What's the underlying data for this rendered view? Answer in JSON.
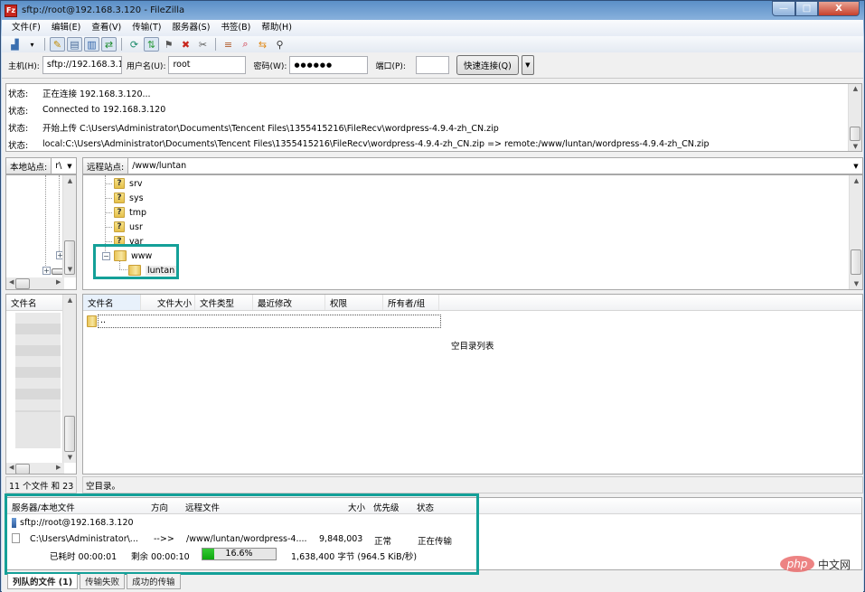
{
  "window": {
    "title": "sftp://root@192.168.3.120 - FileZilla",
    "app_icon": "Fz",
    "controls": {
      "minimize": "—",
      "maximize": "□",
      "close": "X"
    }
  },
  "menu": [
    "文件(F)",
    "编辑(E)",
    "查看(V)",
    "传输(T)",
    "服务器(S)",
    "书签(B)",
    "帮助(H)"
  ],
  "toolbar": {
    "icons": [
      "site-manager-icon",
      "dropdown-arrow-icon",
      "toggle-log-icon",
      "toggle-local-tree-icon",
      "toggle-remote-tree-icon",
      "toggle-queue-icon",
      "refresh-icon",
      "process-queue-icon",
      "cancel-icon",
      "stop-icon",
      "disconnect-icon",
      "filter-icon",
      "compare-icon",
      "sync-browse-icon",
      "search-icon"
    ],
    "glyphs": [
      "▟",
      "▾",
      "✎",
      "▤",
      "▥",
      "⇄",
      "⟳",
      "⇅",
      "⚑",
      "✖",
      "✂",
      "≡",
      "⌕",
      "⇆",
      "⚲"
    ]
  },
  "quickconnect": {
    "host_label": "主机(H):",
    "host_value": "sftp://192.168.3.1:",
    "user_label": "用户名(U):",
    "user_value": "root",
    "pass_label": "密码(W):",
    "pass_value": "●●●●●●",
    "port_label": "端口(P):",
    "port_value": "",
    "connect_button": "快速连接(Q)",
    "dropdown": "▼"
  },
  "log": [
    {
      "tag": "状态:",
      "text": "正在连接 192.168.3.120..."
    },
    {
      "tag": "状态:",
      "text": "Connected to 192.168.3.120"
    },
    {
      "tag": "状态:",
      "text": "开始上传 C:\\Users\\Administrator\\Documents\\Tencent Files\\1355415216\\FileRecv\\wordpress-4.9.4-zh_CN.zip"
    },
    {
      "tag": "状态:",
      "text": "local:C:\\Users\\Administrator\\Documents\\Tencent Files\\1355415216\\FileRecv\\wordpress-4.9.4-zh_CN.zip => remote:/www/luntan/wordpress-4.9.4-zh_CN.zip"
    }
  ],
  "local_site": {
    "label": "本地站点:",
    "value": "r\\"
  },
  "remote_site": {
    "label": "远程站点:",
    "value": "/www/luntan"
  },
  "remote_tree": [
    {
      "name": "srv",
      "icon": "unknown-folder-icon"
    },
    {
      "name": "sys",
      "icon": "unknown-folder-icon"
    },
    {
      "name": "tmp",
      "icon": "unknown-folder-icon"
    },
    {
      "name": "usr",
      "icon": "unknown-folder-icon"
    },
    {
      "name": "var",
      "icon": "unknown-folder-icon"
    },
    {
      "name": "www",
      "icon": "folder-icon",
      "expanded": true
    },
    {
      "name": "luntan",
      "icon": "folder-icon",
      "selected": true
    }
  ],
  "local_list": {
    "header": "文件名",
    "status": "11 个文件 和 23 ·"
  },
  "remote_list": {
    "columns": [
      "文件名",
      "文件大小",
      "文件类型",
      "最近修改",
      "权限",
      "所有者/组"
    ],
    "rows": [
      {
        "name": ".."
      }
    ],
    "empty_text": "空目录列表",
    "status": "空目录。"
  },
  "queue": {
    "columns": [
      "服务器/本地文件",
      "方向",
      "远程文件",
      "大小",
      "优先级",
      "状态"
    ],
    "server": "sftp://root@192.168.3.120",
    "item": {
      "local": "C:\\Users\\Administrator\\...",
      "direction": "-->>",
      "remote": "/www/luntan/wordpress-4....",
      "size": "9,848,003",
      "priority": "正常",
      "status": "正在传输"
    },
    "elapsed": "已耗时 00:00:01",
    "remaining": "剩余 00:00:10",
    "progress_percent": 16.6,
    "progress_label": "16.6%",
    "transferred": "1,638,400 字节 (964.5 KiB/秒)"
  },
  "tabs": [
    {
      "label": "列队的文件 (1)",
      "active": true
    },
    {
      "label": "传输失败",
      "active": false
    },
    {
      "label": "成功的传输",
      "active": false
    }
  ],
  "watermark": {
    "php": "php",
    "cn": "中文网"
  },
  "highlight_color": "#14a098"
}
